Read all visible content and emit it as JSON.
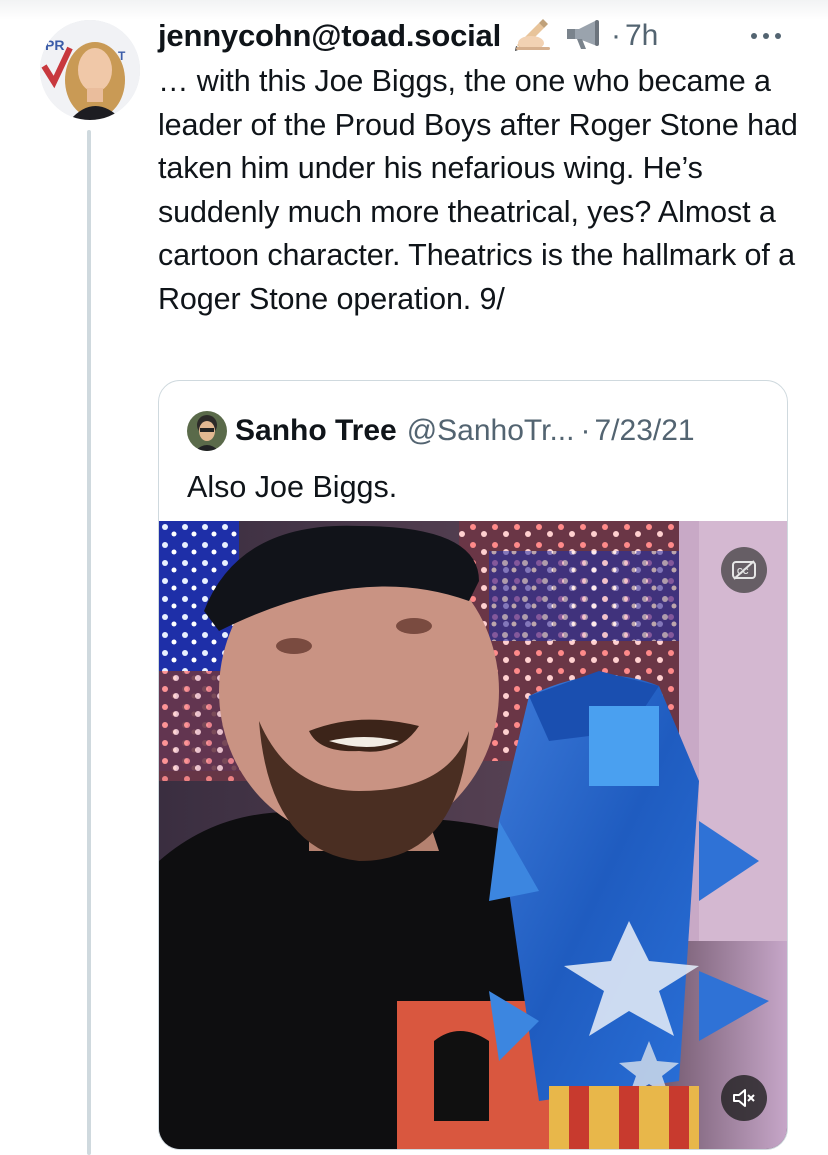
{
  "tweet": {
    "author_handle": "jennycohn@toad.social",
    "emoji_1": "writing-hand-emoji",
    "emoji_2": "megaphone-emoji",
    "separator": "·",
    "time": "7h",
    "more_icon": "more-icon",
    "text": "… with this Joe Biggs, the one who became a leader of the Proud Boys after Roger Stone had taken him under his nefarious wing. He’s suddenly much more theatrical, yes? Almost a cartoon character. Theatrics is the hallmark of a Roger Stone operation. 9/"
  },
  "quote": {
    "author_name": "Sanho Tree",
    "author_handle": "@SanhoTr...",
    "separator": "·",
    "date": "7/23/21",
    "text": "Also Joe Biggs.",
    "media": {
      "type": "video",
      "captions_icon": "closed-captions-off-icon",
      "mute_icon": "speaker-muted-icon"
    }
  },
  "colors": {
    "text_primary": "#0f1419",
    "text_secondary": "#536471",
    "border": "#cfd9de"
  }
}
